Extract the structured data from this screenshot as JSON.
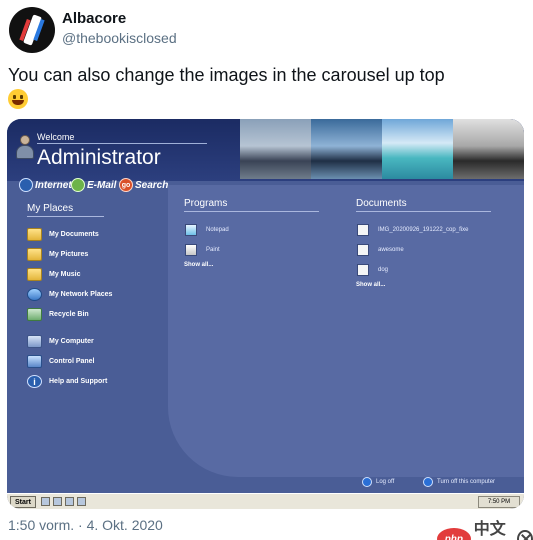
{
  "tweet": {
    "display_name": "Albacore",
    "handle": "@thebookisclosed",
    "text": "You can also change the images in the carousel up top",
    "timestamp": "1:50 vorm. · 4. Okt. 2020"
  },
  "xp": {
    "welcome": "Welcome",
    "username": "Administrator",
    "quick_links": [
      {
        "label": "Internet",
        "icon": "globe-icon"
      },
      {
        "label": "E-Mail",
        "icon": "mail-icon"
      },
      {
        "label": "Search",
        "icon": "search-icon",
        "badge": "go"
      }
    ],
    "places_title": "My Places",
    "places": [
      {
        "label": "My Documents",
        "icon": "folder-icon"
      },
      {
        "label": "My Pictures",
        "icon": "folder-icon"
      },
      {
        "label": "My Music",
        "icon": "folder-icon"
      },
      {
        "label": "My Network Places",
        "icon": "network-icon"
      },
      {
        "label": "Recycle Bin",
        "icon": "recycle-bin-icon"
      },
      {
        "label": "My Computer",
        "icon": "computer-icon"
      },
      {
        "label": "Control Panel",
        "icon": "control-panel-icon"
      },
      {
        "label": "Help and Support",
        "icon": "help-icon"
      }
    ],
    "programs": {
      "title": "Programs",
      "items": [
        {
          "label": "Notepad",
          "icon": "notepad-icon"
        },
        {
          "label": "Paint",
          "icon": "paint-icon"
        }
      ],
      "show_all": "Show all..."
    },
    "documents": {
      "title": "Documents",
      "items": [
        {
          "label": "IMG_20200926_191222_cop_fixe",
          "icon": "document-icon"
        },
        {
          "label": "awesome",
          "icon": "document-icon"
        },
        {
          "label": "dog",
          "icon": "document-icon"
        }
      ],
      "show_all": "Show all..."
    },
    "log_off": "Log off",
    "turn_off": "Turn off this computer",
    "taskbar": {
      "start": "Start",
      "clock": "7:50 PM"
    }
  },
  "watermark": {
    "badge": "php",
    "text": "中文网"
  }
}
